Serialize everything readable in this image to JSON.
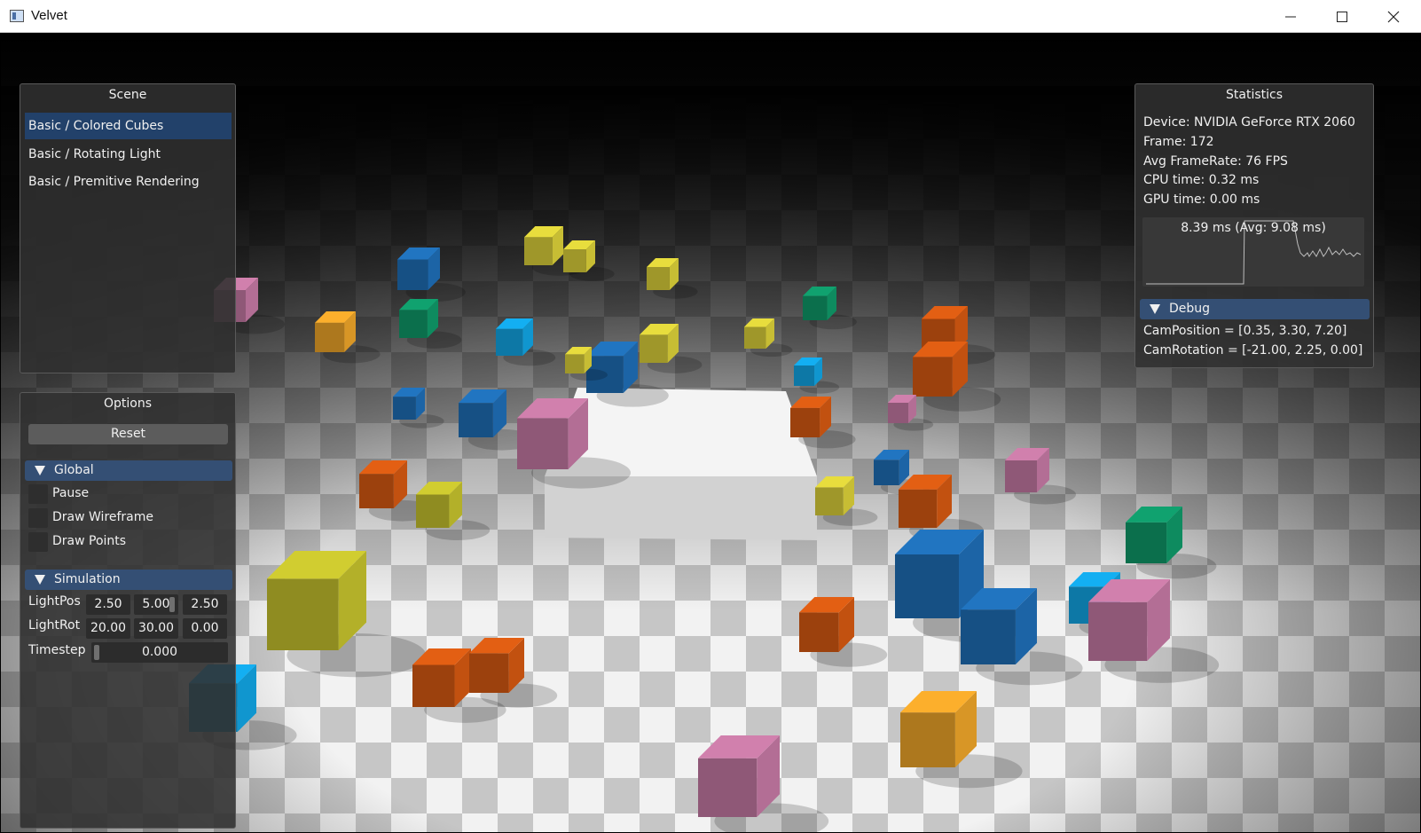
{
  "window": {
    "title": "Velvet",
    "controls": {
      "minimize": "minimize-icon",
      "maximize": "maximize-icon",
      "close": "close-icon"
    }
  },
  "scene_panel": {
    "title": "Scene",
    "items": [
      {
        "label": "Basic / Colored Cubes",
        "selected": true
      },
      {
        "label": "Basic / Rotating Light",
        "selected": false
      },
      {
        "label": "Basic / Premitive Rendering",
        "selected": false
      }
    ]
  },
  "options_panel": {
    "title": "Options",
    "reset_label": "Reset",
    "global": {
      "label": "Global",
      "checkboxes": [
        {
          "label": "Pause",
          "checked": false
        },
        {
          "label": "Draw Wireframe",
          "checked": false
        },
        {
          "label": "Draw Points",
          "checked": false
        }
      ]
    },
    "simulation": {
      "label": "Simulation",
      "light_pos": {
        "label": "LightPos",
        "values": [
          "2.50",
          "5.00",
          "2.50"
        ]
      },
      "light_rot": {
        "label": "LightRot",
        "values": [
          "20.00",
          "30.00",
          "0.00"
        ]
      },
      "timestep": {
        "label": "Timestep",
        "value": "0.000"
      }
    }
  },
  "stats_panel": {
    "title": "Statistics",
    "device": "Device:  NVIDIA GeForce RTX 2060",
    "frame": "Frame:  172",
    "framerate": "Avg FrameRate:  76 FPS",
    "cpu_time": "CPU time:  0.32 ms",
    "gpu_time": "GPU time:  0.00 ms",
    "graph_label": "8.39 ms (Avg: 9.08 ms)",
    "debug": {
      "label": "Debug",
      "cam_position": "CamPosition = [0.35, 3.30, 7.20]",
      "cam_rotation": "CamRotation = [-21.00, 2.25, 0.00]"
    }
  },
  "colors": {
    "accent": "#22416a",
    "header": "#344f74",
    "cube_blue": "#1f6fb8",
    "cube_cyan": "#12a7e6",
    "cube_yellow": "#ddd23a",
    "cube_orange": "#d85a12",
    "cube_pink": "#c77aa5",
    "cube_green": "#0f9a6a",
    "cube_olive": "#c7c32e",
    "cube_amber": "#f0a72a"
  }
}
